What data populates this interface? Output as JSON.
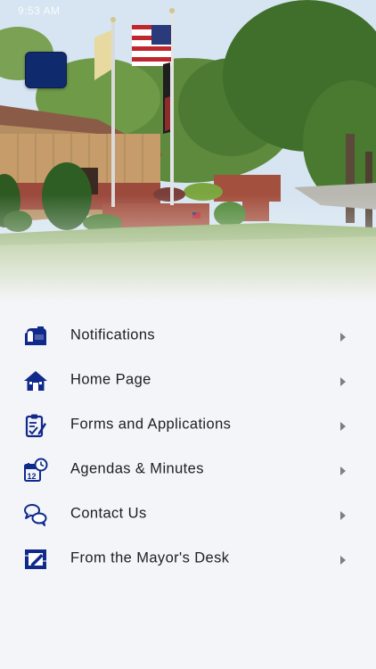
{
  "status_bar": {
    "time": "9:53 AM"
  },
  "hero": {
    "menu_button_icon": "menu-icon"
  },
  "menu": {
    "items": [
      {
        "label": "Notifications",
        "icon": "mailbox-icon"
      },
      {
        "label": "Home Page",
        "icon": "house-icon"
      },
      {
        "label": "Forms and Applications",
        "icon": "clipboard-icon"
      },
      {
        "label": "Agendas & Minutes",
        "icon": "calendar-clock-icon"
      },
      {
        "label": "Contact Us",
        "icon": "speech-bubbles-icon"
      },
      {
        "label": "From the Mayor's Desk",
        "icon": "notepad-icon"
      }
    ]
  },
  "colors": {
    "icon_blue": "#102a8c",
    "menu_button": "#102a6e",
    "background": "#f4f5f8"
  }
}
